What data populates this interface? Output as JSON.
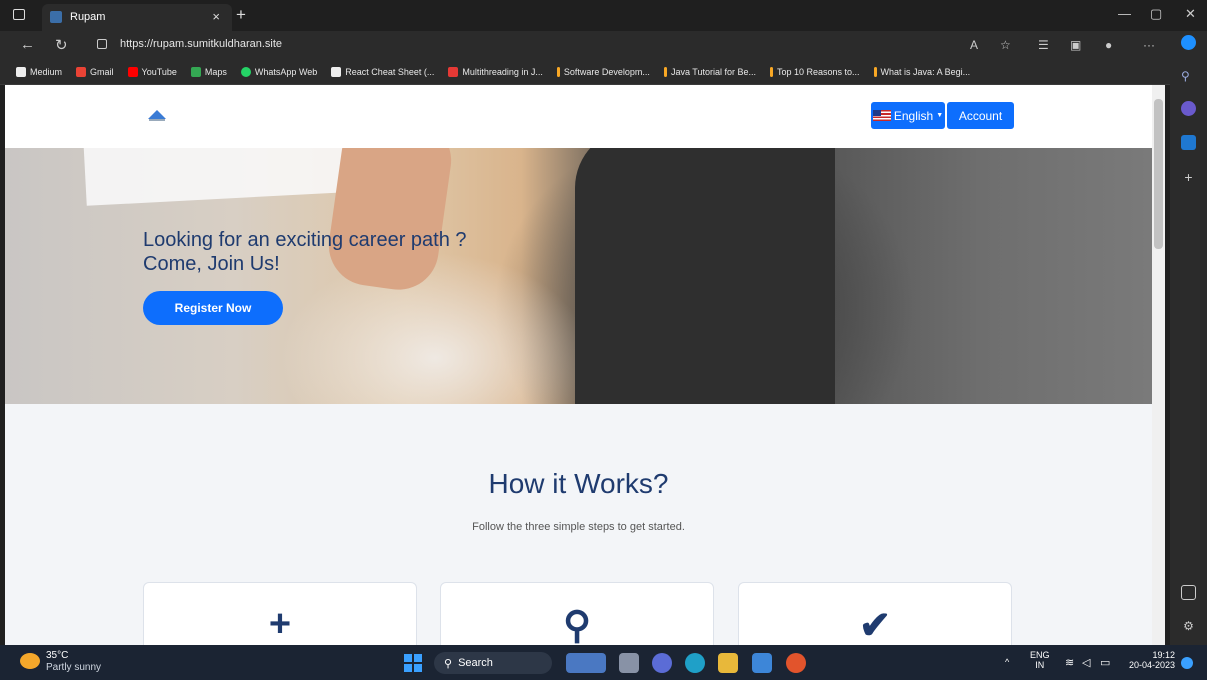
{
  "browser": {
    "tab_title": "Rupam",
    "url": "https://rupam.sumitkuldharan.site",
    "bookmarks": [
      "Medium",
      "Gmail",
      "YouTube",
      "Maps",
      "WhatsApp Web",
      "React Cheat Sheet (...",
      "Multithreading in J...",
      "Software Developm...",
      "Java Tutorial for Be...",
      "Top 10 Reasons to...",
      "What is Java: A Begi..."
    ]
  },
  "header": {
    "language_label": "English",
    "account_label": "Account"
  },
  "hero": {
    "title_line1": "Looking for an exciting career path ?",
    "title_line2": "Come, Join Us!",
    "register_label": "Register Now"
  },
  "how": {
    "title": "How it Works?",
    "subtitle": "Follow the three simple steps to get started.",
    "cards": [
      {
        "icon": "plus-icon",
        "glyph": "+"
      },
      {
        "icon": "search-icon",
        "glyph": "⚲"
      },
      {
        "icon": "check-icon",
        "glyph": "✔"
      }
    ]
  },
  "taskbar": {
    "temperature": "35°C",
    "weather": "Partly sunny",
    "search_label": "Search",
    "lang_top": "ENG",
    "lang_bottom": "IN",
    "time": "19:12",
    "date": "20-04-2023"
  }
}
